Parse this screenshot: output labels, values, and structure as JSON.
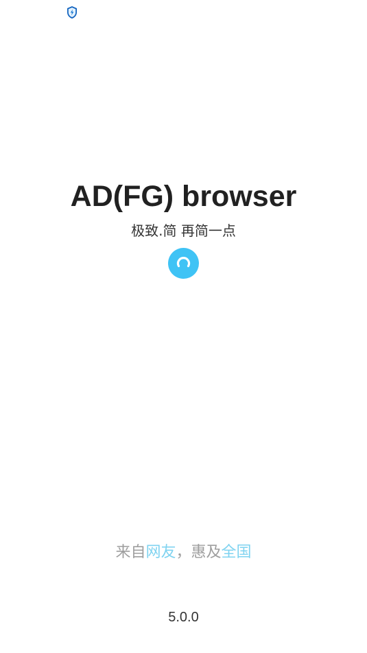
{
  "status_bar": {
    "icon": "shield-notification-icon"
  },
  "splash": {
    "app_title": "AD(FG) browser",
    "tagline": "极致.简 再简一点",
    "loading_icon": "spinner-icon",
    "slogan": {
      "part1": "来自",
      "part2": "网友",
      "part3": "，惠及",
      "part4": "全国"
    },
    "version": "5.0.0"
  },
  "colors": {
    "accent": "#3fc3f5",
    "slogan_highlight": "#7fd3f0",
    "slogan_text": "#9e9e9e",
    "title_text": "#212121"
  }
}
